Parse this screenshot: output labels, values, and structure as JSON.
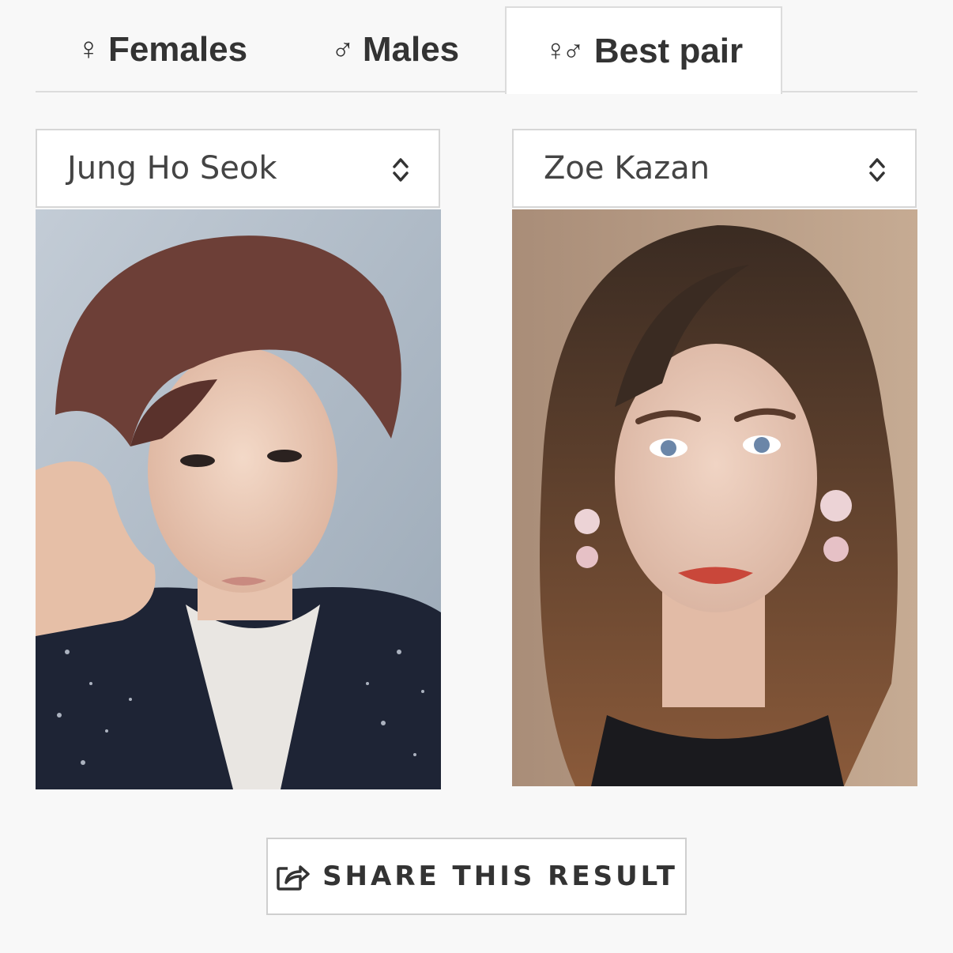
{
  "tabs": [
    {
      "label": "Females",
      "glyph": "♀",
      "icon": "female-icon"
    },
    {
      "label": "Males",
      "glyph": "♂",
      "icon": "male-icon"
    },
    {
      "label": "Best pair",
      "glyph": "♀♂",
      "icon": "pair-icon",
      "active": true
    }
  ],
  "left_select": {
    "value": "Jung Ho Seok"
  },
  "right_select": {
    "value": "Zoe Kazan"
  },
  "share_button": {
    "label": "SHARE THIS RESULT",
    "icon": "share-icon"
  }
}
